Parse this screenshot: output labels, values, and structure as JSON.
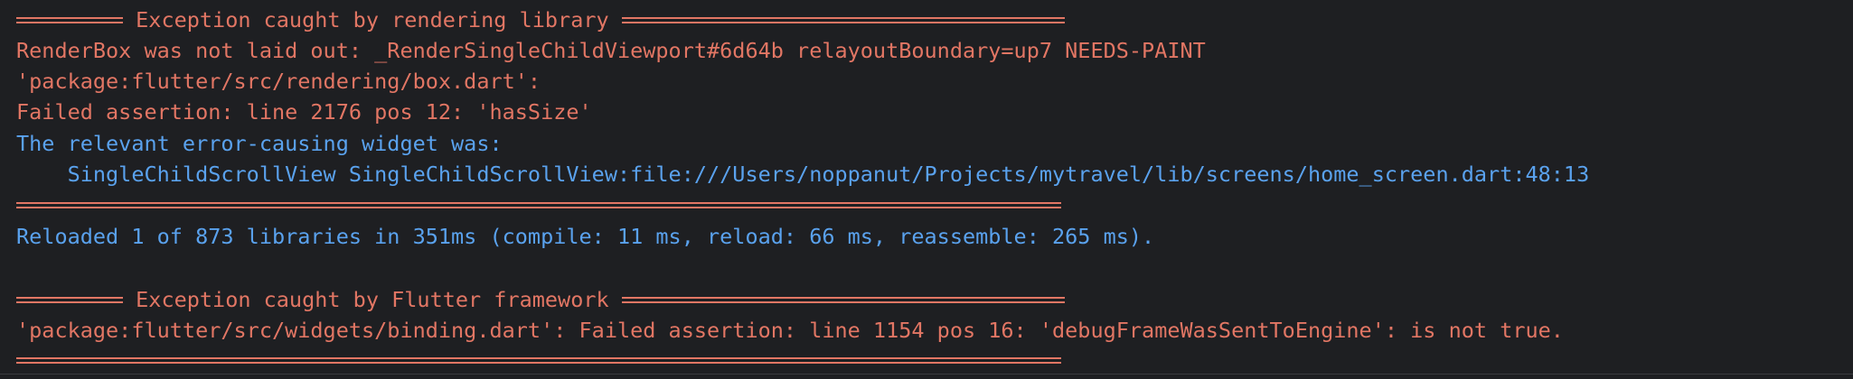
{
  "terminal": {
    "block1": {
      "header": "Exception caught by rendering library",
      "lines": [
        "RenderBox was not laid out: _RenderSingleChildViewport#6d64b relayoutBoundary=up7 NEEDS-PAINT",
        "'package:flutter/src/rendering/box.dart':",
        "Failed assertion: line 2176 pos 12: 'hasSize'"
      ],
      "relevant_label": "The relevant error-causing widget was:",
      "widget_link": "    SingleChildScrollView SingleChildScrollView:file:///Users/noppanut/Projects/mytravel/lib/screens/home_screen.dart:48:13"
    },
    "reload_message": "Reloaded 1 of 873 libraries in 351ms (compile: 11 ms, reload: 66 ms, reassemble: 265 ms).",
    "block2": {
      "header": "Exception caught by Flutter framework",
      "lines": [
        "'package:flutter/src/widgets/binding.dart': Failed assertion: line 1154 pos 16: 'debugFrameWasSentToEngine': is not true."
      ]
    },
    "colors": {
      "background": "#1e1f22",
      "error_red": "#e27664",
      "info_blue": "#5aa2ee"
    }
  }
}
